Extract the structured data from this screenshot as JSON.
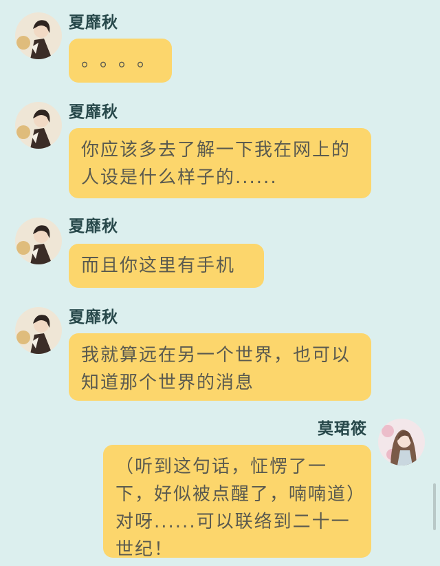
{
  "messages": [
    {
      "sender": "夏靡秋",
      "side": "left",
      "avatar": "male-avatar",
      "text": "。。。。"
    },
    {
      "sender": "夏靡秋",
      "side": "left",
      "avatar": "male-avatar",
      "text": "你应该多去了解一下我在网上的人设是什么样子的......"
    },
    {
      "sender": "夏靡秋",
      "side": "left",
      "avatar": "male-avatar",
      "text": "而且你这里有手机"
    },
    {
      "sender": "夏靡秋",
      "side": "left",
      "avatar": "male-avatar",
      "text": "我就算远在另一个世界，也可以知道那个世界的消息"
    },
    {
      "sender": "莫珺筱",
      "side": "right",
      "avatar": "female-avatar",
      "text": "（听到这句话，怔愣了一下，好似被点醒了，喃喃道）对呀......可以联络到二十一世纪！"
    }
  ],
  "colors": {
    "background": "#dcefee",
    "bubble": "#fcd66c",
    "name": "#27484a",
    "text": "#5a5a4f"
  }
}
